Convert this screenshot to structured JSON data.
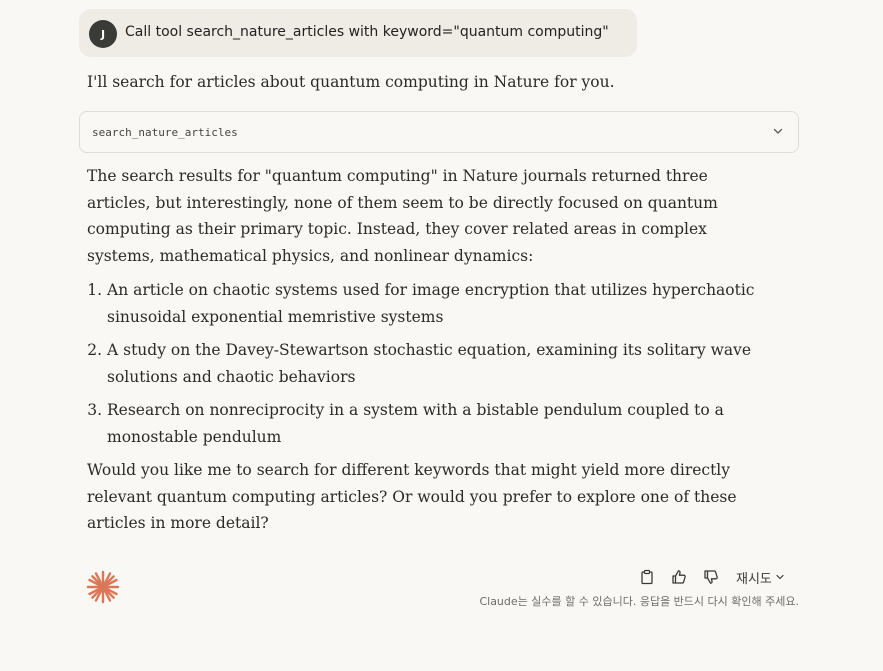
{
  "user_message": {
    "avatar_initial": "J",
    "text": "Call tool search_nature_articles with keyword=\"quantum computing\""
  },
  "assistant": {
    "intro": "I'll search for articles about quantum computing in Nature for you.",
    "tool_call": {
      "name": "search_nature_articles",
      "icon": "chevron-down-icon"
    },
    "paragraph": "The search results for \"quantum computing\" in Nature journals returned three articles, but interestingly, none of them seem to be directly focused on quantum computing as their primary topic. Instead, they cover related areas in complex systems, mathematical physics, and nonlinear dynamics:",
    "list": [
      "An article on chaotic systems used for image encryption that utilizes hyperchaotic sinusoidal exponential memristive systems",
      "A study on the Davey-Stewartson stochastic equation, examining its solitary wave solutions and chaotic behaviors",
      "Research on nonreciprocity in a system with a bistable pendulum coupled to a monostable pendulum"
    ],
    "closing": "Would you like me to search for different keywords that might yield more directly relevant quantum computing articles? Or would you prefer to explore one of these articles in more detail?"
  },
  "footer": {
    "logo_icon": "claude-asterisk-icon",
    "actions": {
      "copy_icon": "clipboard-icon",
      "like_icon": "thumbs-up-icon",
      "dislike_icon": "thumbs-down-icon",
      "retry_label": "재시도"
    },
    "disclaimer": "Claude는 실수를 할 수 있습니다. 응답을 반드시 다시 확인해 주세요."
  },
  "colors": {
    "background": "#f9f8f5",
    "user_bubble": "#eeece5",
    "avatar": "#3a3a37",
    "brand_orange": "#d97757",
    "text": "#2b2a27"
  }
}
